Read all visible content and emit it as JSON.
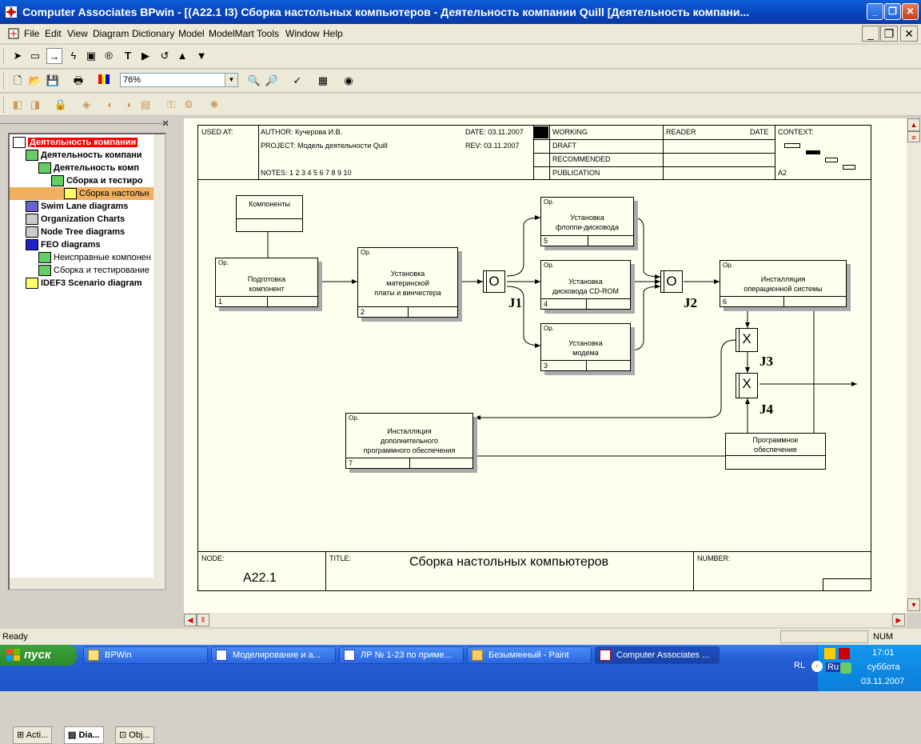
{
  "window": {
    "title": "Computer Associates BPwin - [(A22.1 I3) Сборка настольных компьютеров - Деятельность компании Quill  [Деятельность компани...",
    "minimize_icon": "minimize-icon",
    "maximize_icon": "maximize-icon",
    "close_icon": "close-icon"
  },
  "menu": [
    "File",
    "Edit",
    "View",
    "Diagram",
    "Dictionary",
    "Model",
    "ModelMart",
    "Tools",
    "Window",
    "Help"
  ],
  "toolbar": {
    "zoom_value": "76%"
  },
  "tree": {
    "items": [
      {
        "label": "Деятельность компании",
        "style": "selected"
      },
      {
        "label": "Деятельность компани",
        "style": "bold"
      },
      {
        "label": "Деятельность комп",
        "style": "bold"
      },
      {
        "label": "Сборка и тестиро",
        "style": "bold"
      },
      {
        "label": "Сборка настольн",
        "style": "highlight"
      },
      {
        "label": "Swim Lane diagrams",
        "style": "bold"
      },
      {
        "label": "Organization Charts",
        "style": "bold"
      },
      {
        "label": "Node Tree diagrams",
        "style": "bold"
      },
      {
        "label": "FEO diagrams",
        "style": "bold"
      },
      {
        "label": "Неисправные компонен",
        "style": "normal"
      },
      {
        "label": "Сборка и тестирование",
        "style": "normal"
      },
      {
        "label": "IDEF3 Scenario diagram",
        "style": "bold"
      }
    ],
    "tabs": [
      "Acti...",
      "Dia...",
      "Obj..."
    ]
  },
  "diagram": {
    "header": {
      "used_at": "USED AT:",
      "author": "AUTHOR:  Кучерова И.В.",
      "project": "PROJECT:  Модель деятельности Quill",
      "date": "DATE: 03.11.2007",
      "rev": "REV:  03.11.2007",
      "notes": "NOTES:  1  2  3  4  5  6  7  8  9  10",
      "working": "WORKING",
      "draft": "DRAFT",
      "recommended": "RECOMMENDED",
      "publication": "PUBLICATION",
      "reader": "READER",
      "reader_date": "DATE",
      "context": "CONTEXT:",
      "context_node": "A2"
    },
    "footer": {
      "node_label": "NODE:",
      "node_value": "A22.1",
      "title_label": "TITLE:",
      "title_value": "Сборка настольных компьютеров",
      "number_label": "NUMBER:"
    },
    "boxes": [
      {
        "id": "1",
        "op": "Op.",
        "lines": [
          "Подготовка",
          "компонент"
        ]
      },
      {
        "id": "2",
        "op": "Op.",
        "lines": [
          "Установка",
          "материнской",
          "платы и винчестера"
        ]
      },
      {
        "id": "5",
        "op": "Op.",
        "lines": [
          "Установка",
          "флоппи-дисковода"
        ]
      },
      {
        "id": "4",
        "op": "Op.",
        "lines": [
          "Установка",
          "дисковода CD-ROM"
        ]
      },
      {
        "id": "3",
        "op": "Op.",
        "lines": [
          "Установка",
          "модема"
        ]
      },
      {
        "id": "6",
        "op": "Op.",
        "lines": [
          "Инсталляция",
          "операционной системы"
        ]
      },
      {
        "id": "7",
        "op": "Op.",
        "lines": [
          "Инсталляция",
          "дополнительного",
          "программного обеспечения"
        ]
      }
    ],
    "referents": [
      {
        "label": "Компоненты"
      },
      {
        "label": "Программное обеспечение"
      }
    ],
    "junctions": [
      {
        "label": "J1",
        "type": "O"
      },
      {
        "label": "J2",
        "type": "O"
      },
      {
        "label": "J3",
        "type": "X"
      },
      {
        "label": "J4",
        "type": "X"
      }
    ]
  },
  "status": {
    "text": "Ready",
    "num": "NUM"
  },
  "taskbar": {
    "start": "пуск",
    "tasks": [
      "BPWin",
      "Моделирование и а...",
      "ЛР № 1-23 по приме...",
      "Безымянный - Paint",
      "Computer Associates ..."
    ],
    "lang": "RL",
    "lang2": "Ru",
    "time": "17:01",
    "day": "суббота",
    "date": "03.11.2007"
  }
}
